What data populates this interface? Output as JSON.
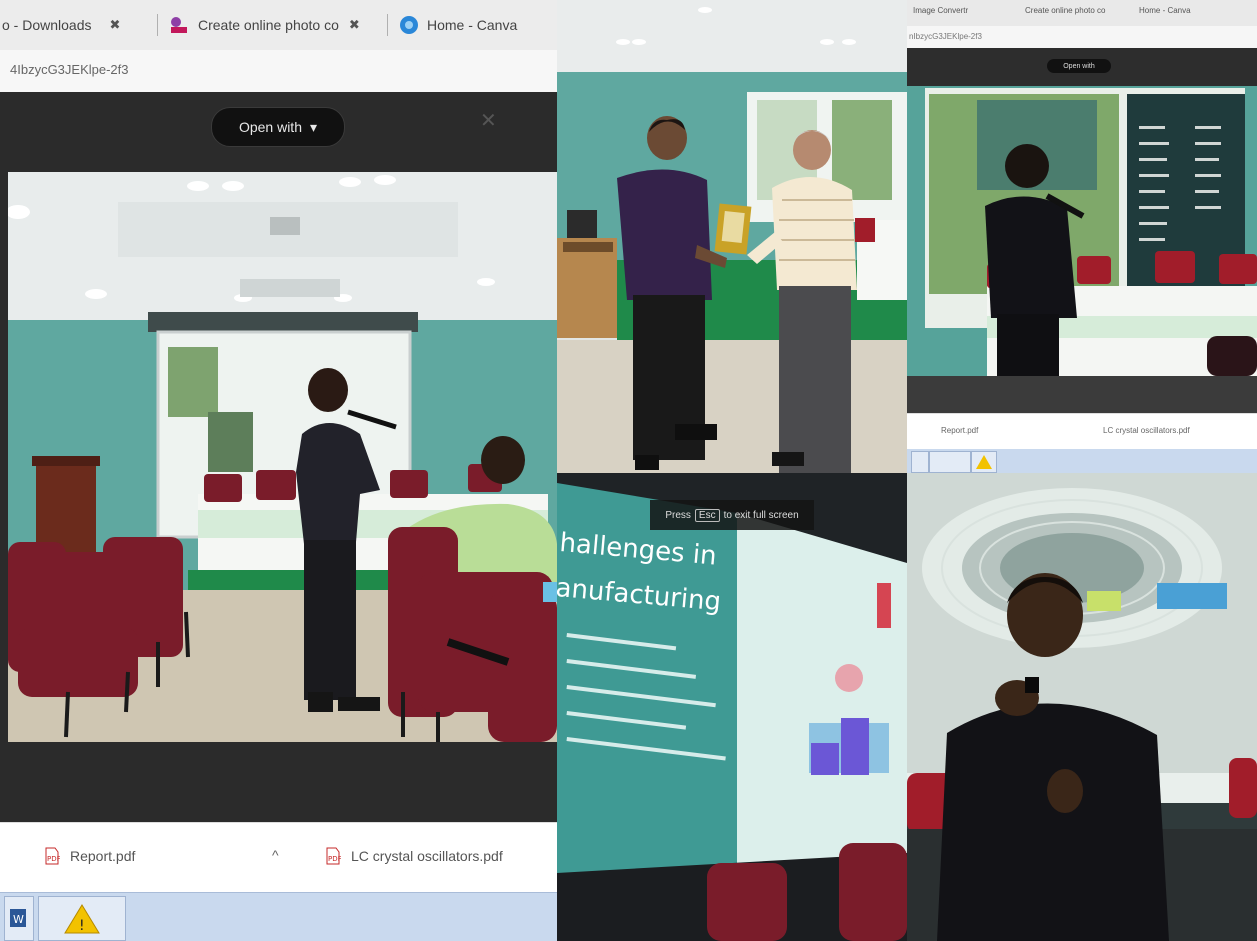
{
  "browser": {
    "tabs": [
      {
        "label": "o - Downloads",
        "close": "✖"
      },
      {
        "label": "Create online photo co",
        "close": "✖"
      },
      {
        "label": "Home - Canva",
        "close": ""
      }
    ],
    "url": "4IbzycG3JEKlpe-2f3",
    "open_with": "Open with",
    "close_symbol": "✕"
  },
  "downloads": [
    {
      "name": "Report.pdf",
      "chevron": "^"
    },
    {
      "name": "LC crystal oscillators.pdf",
      "chevron": ""
    }
  ],
  "mini_browser": {
    "tabs": [
      "Image Convertr",
      "Create online photo co",
      "Home - Canva"
    ],
    "url": "nIbzycG3JEKlpe-2f3",
    "open_with": "Open with",
    "downloads": [
      "Report.pdf",
      "LC crystal oscillators.pdf"
    ]
  },
  "slide": {
    "esc_prefix": "Press",
    "esc_key": "Esc",
    "esc_suffix": "to exit full screen",
    "title_line1": "hallenges in",
    "title_line2": "anufacturing"
  },
  "colors": {
    "room_wall": "#5fa8a0",
    "chair": "#7a1c2a",
    "accent_green": "#1f8a4a"
  }
}
